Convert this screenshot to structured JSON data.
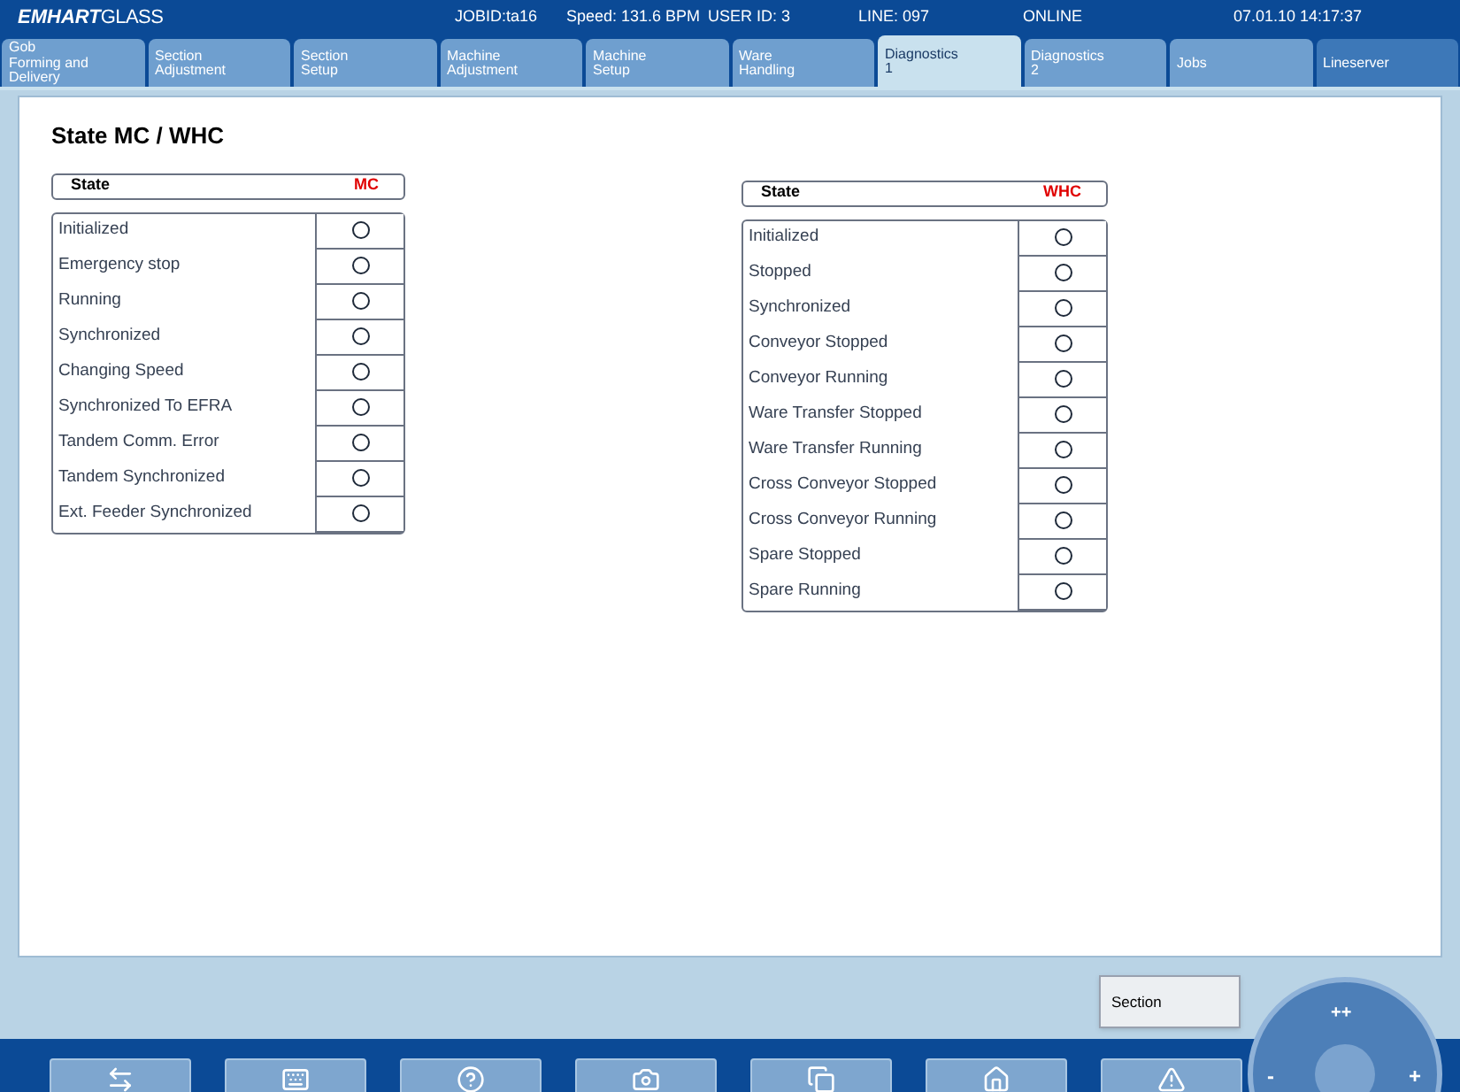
{
  "header": {
    "logo_bold": "EMHART",
    "logo_light": "GLASS",
    "status": [
      "JOBID:ta16",
      "Speed: 131.6 BPM",
      "USER ID: 3",
      "LINE: 097",
      "ONLINE",
      "07.01.10  14:17:37"
    ]
  },
  "tabs": [
    {
      "label": "Gob\nForming and\nDelivery",
      "selected": false
    },
    {
      "label": "Section\nAdjustment",
      "selected": false
    },
    {
      "label": "Section\nSetup",
      "selected": false
    },
    {
      "label": "Machine\nAdjustment",
      "selected": false
    },
    {
      "label": "Machine\nSetup",
      "selected": false
    },
    {
      "label": "Ware\nHandling",
      "selected": false
    },
    {
      "label": "Diagnostics\n1",
      "selected": true
    },
    {
      "label": "Diagnostics\n2",
      "selected": false
    },
    {
      "label": "Jobs",
      "selected": false
    },
    {
      "label": "Lineserver",
      "selected": false
    }
  ],
  "page_title": "State MC / WHC",
  "tables": [
    {
      "state_heading": "State",
      "controller": "MC",
      "rows": [
        {
          "label": "Initialized",
          "on": false
        },
        {
          "label": "Emergency stop",
          "on": false
        },
        {
          "label": "Running",
          "on": false
        },
        {
          "label": "Synchronized",
          "on": false
        },
        {
          "label": "Changing Speed",
          "on": false
        },
        {
          "label": "Synchronized To EFRA",
          "on": false
        },
        {
          "label": "Tandem Comm. Error",
          "on": false
        },
        {
          "label": "Tandem Synchronized",
          "on": false
        },
        {
          "label": "Ext. Feeder Synchronized",
          "on": false
        }
      ]
    },
    {
      "state_heading": "State",
      "controller": "WHC",
      "rows": [
        {
          "label": "Initialized",
          "on": false
        },
        {
          "label": "Stopped",
          "on": false
        },
        {
          "label": "Synchronized",
          "on": false
        },
        {
          "label": "Conveyor Stopped",
          "on": false
        },
        {
          "label": "Conveyor Running",
          "on": false
        },
        {
          "label": "Ware Transfer Stopped",
          "on": false
        },
        {
          "label": "Ware Transfer Running",
          "on": false
        },
        {
          "label": "Cross Conveyor Stopped",
          "on": false
        },
        {
          "label": "Cross Conveyor Running",
          "on": false
        },
        {
          "label": "Spare Stopped",
          "on": false
        },
        {
          "label": "Spare Running",
          "on": false
        }
      ]
    }
  ],
  "section_button": "Section",
  "jog": {
    "up": "++",
    "left": "-",
    "right": "+"
  },
  "toolbar": [
    {
      "kind": "arrows"
    },
    {
      "kind": "keyboard"
    },
    {
      "kind": "help"
    },
    {
      "kind": "camera"
    },
    {
      "kind": "copy"
    },
    {
      "kind": "home"
    },
    {
      "kind": "warning"
    }
  ]
}
